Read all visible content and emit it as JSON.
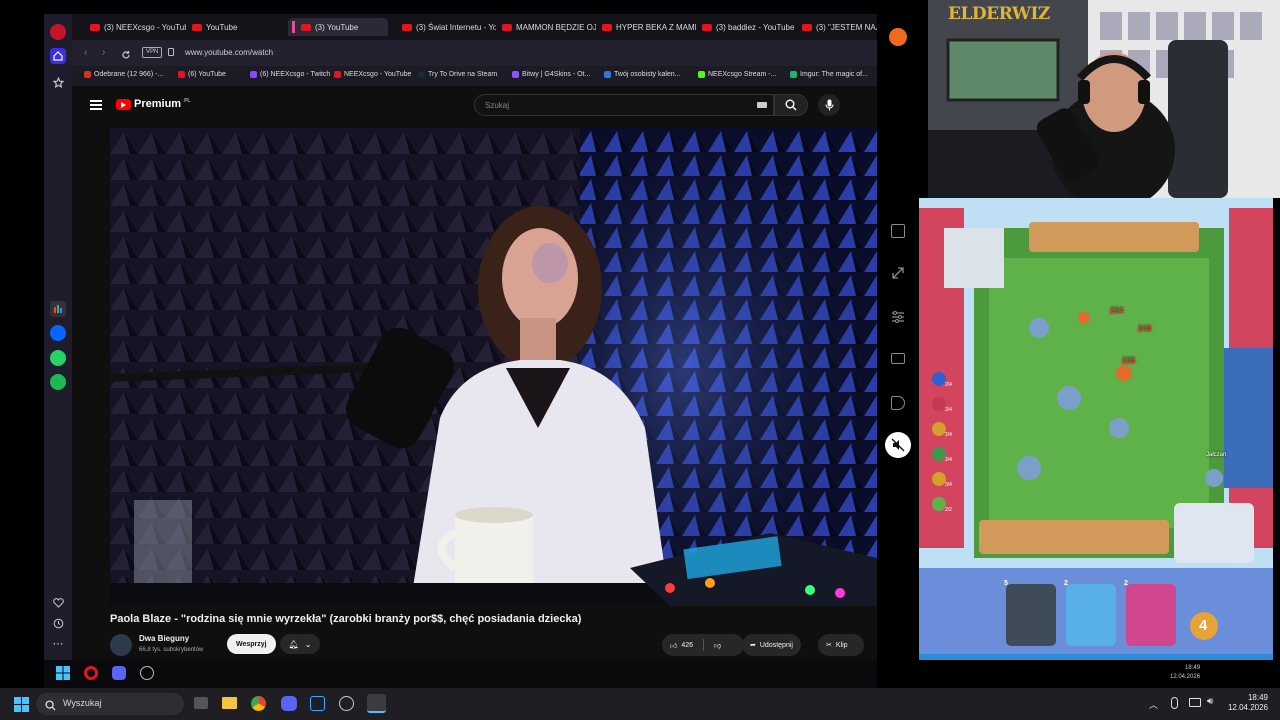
{
  "browser": {
    "tabs": [
      {
        "label": "(3) NEEXcsgo - YouTube"
      },
      {
        "label": "YouTube"
      },
      {
        "label": "(3) YouTube"
      },
      {
        "label": "(3) Świat Internetu - You"
      },
      {
        "label": "MAMMON BĘDZIE OJCE"
      },
      {
        "label": "HYPER BEKA Z MAMMO"
      },
      {
        "label": "(3) baddiez - YouTube"
      },
      {
        "label": "(3) \"JESTEM NAJLEP"
      }
    ],
    "vpn_label": "VPN",
    "url": "www.youtube.com/watch",
    "bookmarks": [
      {
        "label": "Odebrane (12 966) -...",
        "color": "#d93025"
      },
      {
        "label": "(6) YouTube",
        "color": "#e4161d"
      },
      {
        "label": "(6) NEEXcsgo - Twitch",
        "color": "#9146ff"
      },
      {
        "label": "NEEXcsgo - YouTube",
        "color": "#e4161d"
      },
      {
        "label": "Try To Drive na Steam",
        "color": "#1b2838"
      },
      {
        "label": "Bitwy | G4Skins - Ot...",
        "color": "#8c53ff"
      },
      {
        "label": "Twój osobisty kalen...",
        "color": "#2a7ade"
      },
      {
        "label": "NEEXcsgo Stream -...",
        "color": "#53fc18"
      },
      {
        "label": "Imgur: The magic of...",
        "color": "#1bb76e"
      }
    ]
  },
  "youtube": {
    "logo_text": "Premium",
    "logo_superscript": "PL",
    "search_placeholder": "Szukaj",
    "video_title": "Paola Blaze - \"rodzina się mnie wyrzekła\" (zarobki branży por$$, chęć posiadania dziecka)",
    "channel_name": "Dwa Bieguny",
    "channel_subs": "66,8 tys. subskrybentów",
    "support_label": "Wesprzyj",
    "like_count": "426",
    "share_label": "Udostępnij",
    "clip_label": "Klip"
  },
  "webcam": {
    "logo": "ELDERWIZ"
  },
  "game": {
    "player_top_name": "",
    "player_bottom_name": "Jałczan",
    "damage_numbers": [
      "254",
      "240",
      "235"
    ],
    "elixir": "4",
    "card_costs": [
      "5",
      "2",
      "2"
    ],
    "side_counts": [
      "2/4",
      "2/4",
      "2/4",
      "2/4",
      "3/4",
      "2/2"
    ]
  },
  "stream_clock": {
    "time": "18:49",
    "date": "12.04.2026"
  },
  "taskbar": {
    "search_label": "Wyszukaj",
    "time": "18:49",
    "date": "12.04.2026"
  }
}
